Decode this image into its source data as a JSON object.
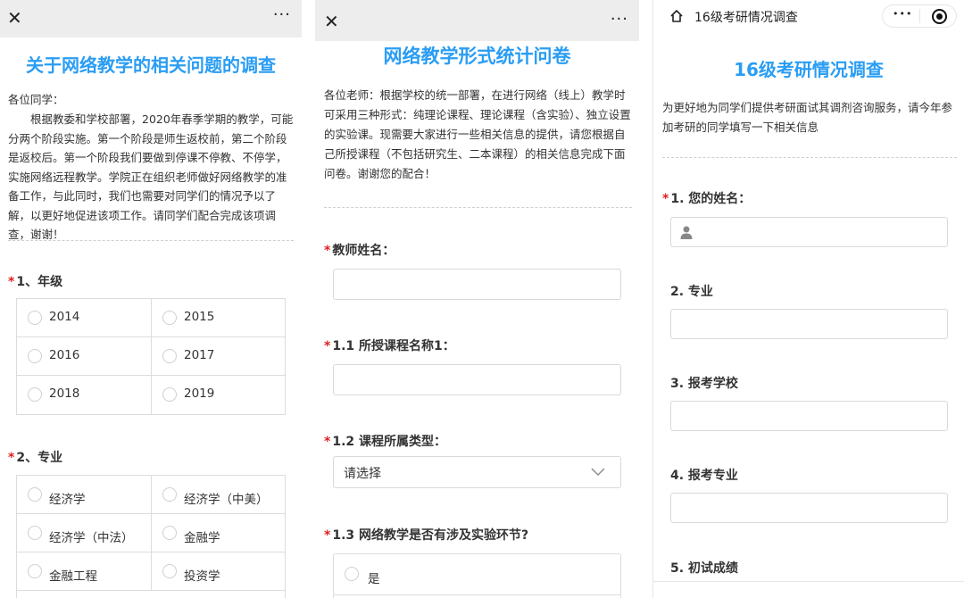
{
  "panel1": {
    "close_icon": "close-icon",
    "more_label": "···",
    "title": "关于网络教学的相关问题的调查",
    "greeting": "各位同学：",
    "intro": "根据教委和学校部署，2020年春季学期的教学，可能分两个阶段实施。第一个阶段是师生返校前，第二个阶段是返校后。第一个阶段我们要做到停课不停教、不停学，实施网络远程教学。学院正在组织老师做好网络教学的准备工作，与此同时，我们也需要对同学们的情况予以了解，以更好地促进该项工作。请同学们配合完成该项调查，谢谢！",
    "q1": {
      "required": "*",
      "label": "1、年级",
      "options": [
        "2014",
        "2015",
        "2016",
        "2017",
        "2018",
        "2019"
      ]
    },
    "q2": {
      "required": "*",
      "label": "2、专业",
      "options": [
        "经济学",
        "经济学（中美）",
        "经济学（中法）",
        "金融学",
        "金融工程",
        "投资学"
      ]
    }
  },
  "panel2": {
    "close_icon": "close-icon",
    "more_label": "···",
    "title": "网络教学形式统计问卷",
    "intro": "各位老师：根据学校的统一部署，在进行网络（线上）教学时可采用三种形式：纯理论课程、理论课程（含实验）、独立设置的实验课。现需要大家进行一些相关信息的提供，请您根据自己所授课程（不包括研究生、二本课程）的相关信息完成下面问卷。谢谢您的配合！",
    "q_name": {
      "required": "*",
      "label": "教师姓名：",
      "value": ""
    },
    "q_course": {
      "required": "*",
      "label": "1.1  所授课程名称1：",
      "value": ""
    },
    "q_type": {
      "required": "*",
      "label": "1.2  课程所属类型：",
      "placeholder": "请选择"
    },
    "q_lab": {
      "required": "*",
      "label": "1.3  网络教学是否有涉及实验环节?",
      "options": [
        "是"
      ]
    }
  },
  "panel3": {
    "home_icon": "home-icon",
    "header_title": "16级考研情况调查",
    "capsule_more": "•••",
    "title": "16级考研情况调查",
    "intro": "为更好地为同学们提供考研面试其调剂咨询服务，请今年参加考研的同学填写一下相关信息",
    "q1": {
      "required": "*",
      "label": "1. 您的姓名：",
      "value": ""
    },
    "q2": {
      "label": "2. 专业",
      "value": ""
    },
    "q3": {
      "label": "3. 报考学校",
      "value": ""
    },
    "q4": {
      "label": "4. 报考专业",
      "value": ""
    },
    "q5": {
      "label": "5. 初试成绩"
    }
  },
  "colors": {
    "accent": "#2a9df4",
    "required": "#e02020",
    "topbar": "#ededed"
  }
}
